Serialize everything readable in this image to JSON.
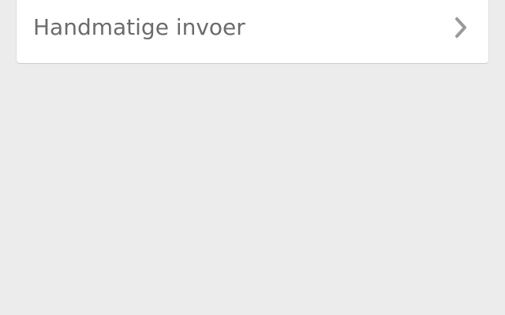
{
  "menu": {
    "items": [
      {
        "label": "Handmatige invoer",
        "icon": "chevron-right-icon"
      }
    ]
  },
  "colors": {
    "background": "#ececec",
    "card": "#ffffff",
    "label": "#6b6b6b",
    "chevron": "#9a9a9a"
  }
}
